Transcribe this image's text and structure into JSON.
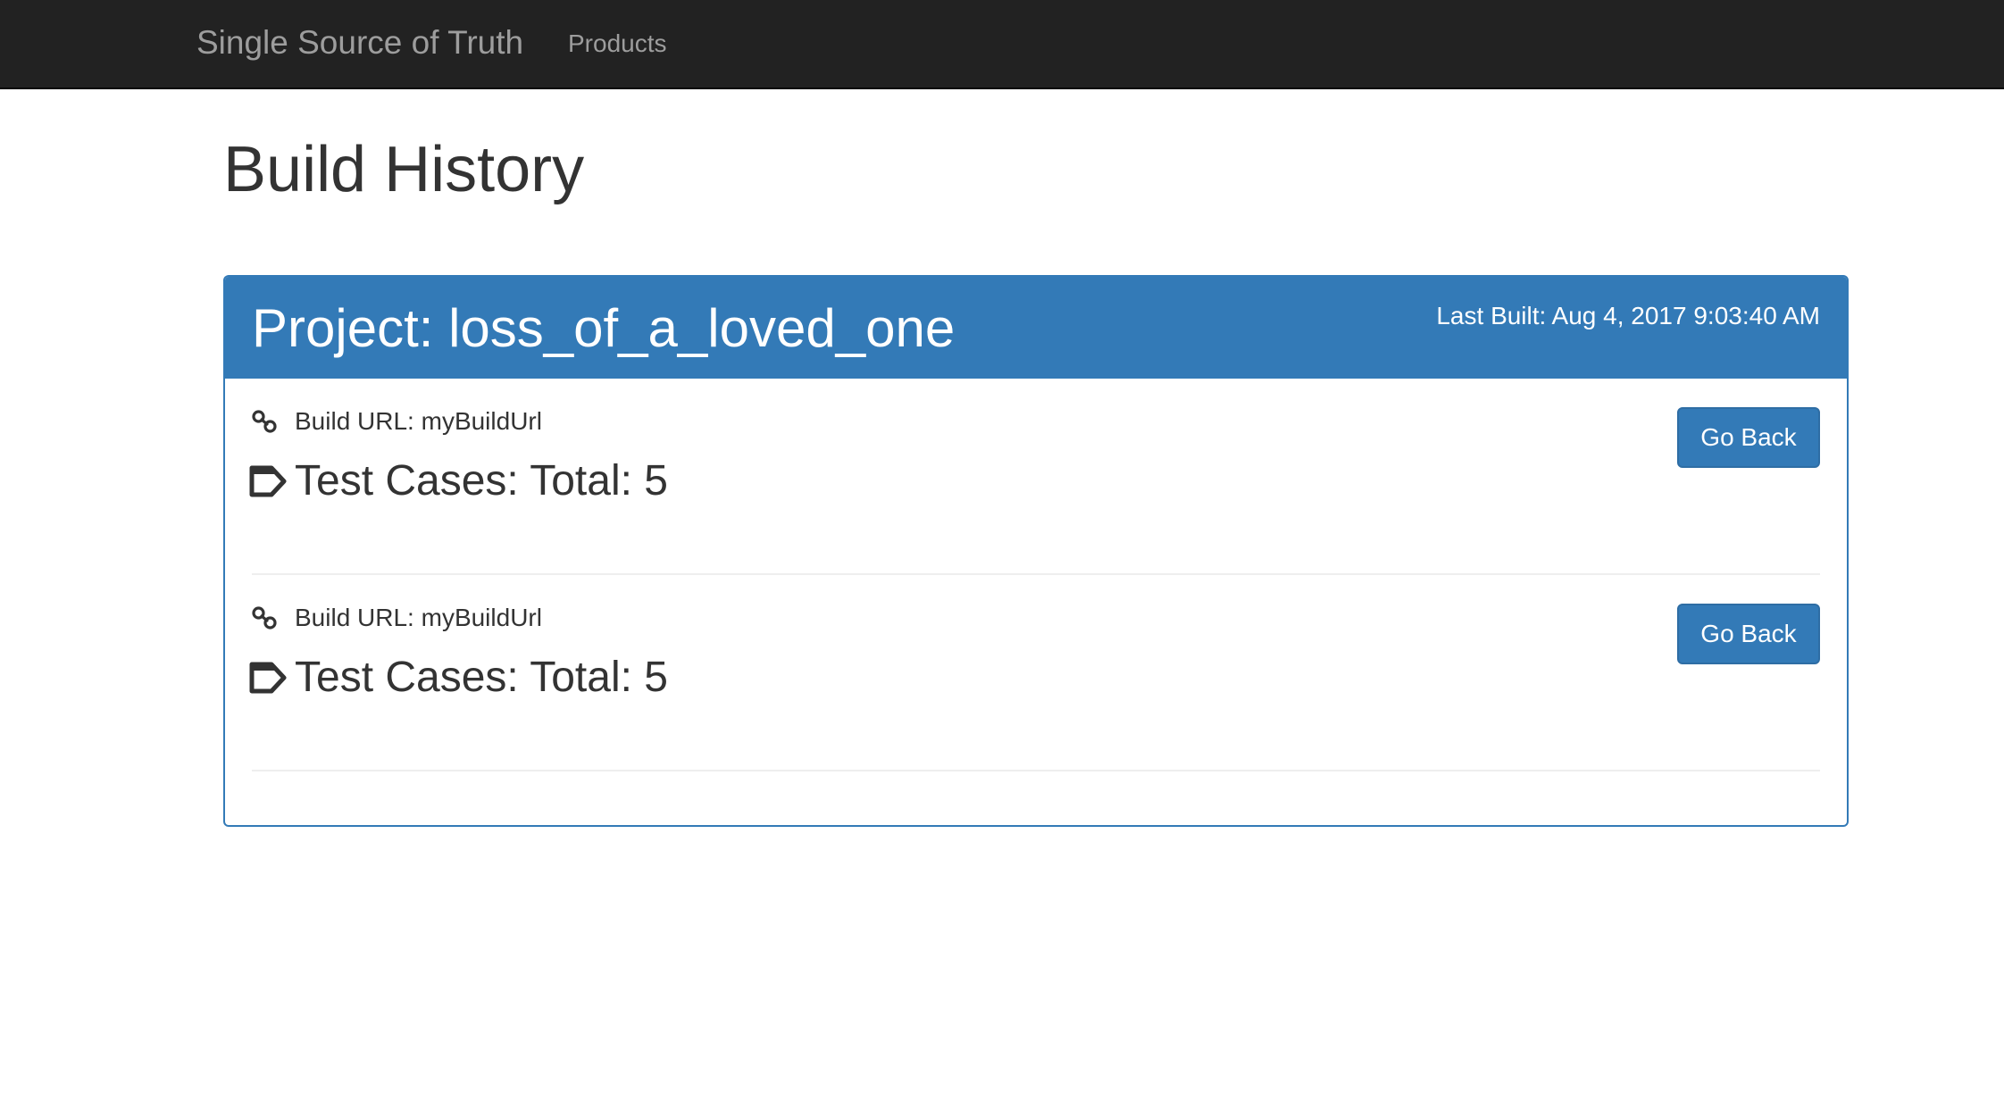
{
  "navbar": {
    "brand": "Single Source of Truth",
    "links": [
      {
        "label": "Products"
      }
    ]
  },
  "page": {
    "title": "Build History"
  },
  "panel": {
    "project_title": "Project: loss_of_a_loved_one",
    "last_built": "Last Built: Aug 4, 2017 9:03:40 AM",
    "builds": [
      {
        "build_url": "Build URL: myBuildUrl",
        "test_cases": "Test Cases: Total: 5",
        "button_label": "Go Back"
      },
      {
        "build_url": "Build URL: myBuildUrl",
        "test_cases": "Test Cases: Total: 5",
        "button_label": "Go Back"
      }
    ]
  },
  "icons": {
    "build_url_icon": "link-icon",
    "test_cases_icon": "tag-icon"
  },
  "colors": {
    "navbar_bg": "#222222",
    "navbar_text": "#9d9d9d",
    "primary": "#337ab7",
    "text": "#333333"
  }
}
